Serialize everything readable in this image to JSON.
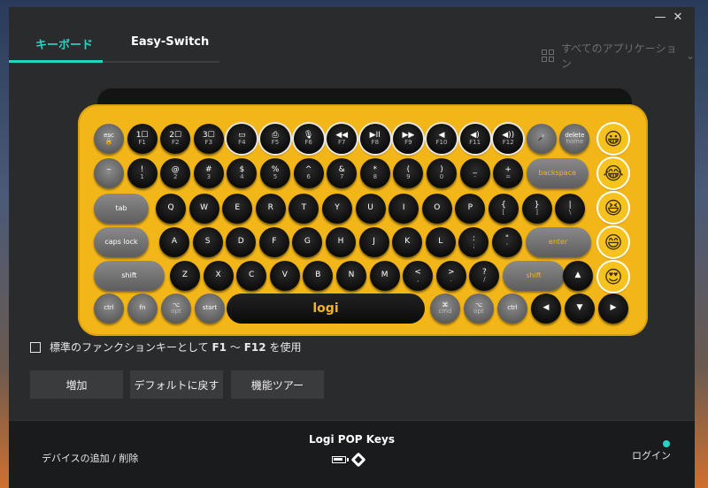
{
  "window": {
    "minimize": "—",
    "close": "✕"
  },
  "tabs": [
    {
      "label": "キーボード"
    },
    {
      "label": "Easy-Switch"
    }
  ],
  "app_switch": {
    "label": "すべてのアプリケーション",
    "chevron": "⌄"
  },
  "keyboard": {
    "brand": "logi",
    "row0": [
      "esc",
      "1☐",
      "2☐",
      "3☐",
      "▭",
      "⎙",
      "🎙",
      "◀◀",
      "▶II",
      "▶▶",
      "◀",
      "◀)",
      "◀))",
      "🎤",
      "delete"
    ],
    "row0_sub": [
      "🔒",
      "F1",
      "F2",
      "F3",
      "F4",
      "F5",
      "F6",
      "F7",
      "F8",
      "F9",
      "F10",
      "F11",
      "F12",
      "",
      "home"
    ],
    "row1": [
      [
        "~",
        "`"
      ],
      [
        "!",
        "1"
      ],
      [
        "@",
        "2"
      ],
      [
        "#",
        "3"
      ],
      [
        "$",
        "4"
      ],
      [
        "%",
        "5"
      ],
      [
        "^",
        "6"
      ],
      [
        "&",
        "7"
      ],
      [
        "*",
        "8"
      ],
      [
        "(",
        "9"
      ],
      [
        ")",
        "0"
      ],
      [
        "_",
        "-"
      ],
      [
        "+",
        "="
      ]
    ],
    "backspace": "backspace",
    "tab": "tab",
    "row2": [
      "Q",
      "W",
      "E",
      "R",
      "T",
      "Y",
      "U",
      "I",
      "O",
      "P"
    ],
    "row2_br": [
      [
        "{",
        "["
      ],
      [
        "}",
        "]"
      ],
      [
        "|",
        "\\"
      ]
    ],
    "capslock": "caps lock",
    "row3": [
      "A",
      "S",
      "D",
      "F",
      "G",
      "H",
      "J",
      "K",
      "L"
    ],
    "row3_punct": [
      [
        ":",
        ";"
      ],
      [
        "\"",
        "'"
      ]
    ],
    "enter": "enter",
    "shift_l": "shift",
    "row4": [
      "Z",
      "X",
      "C",
      "V",
      "B",
      "N",
      "M"
    ],
    "row4_punct": [
      [
        "<",
        ","
      ],
      [
        ">",
        "."
      ],
      [
        "?",
        "/"
      ]
    ],
    "shift_r": "shift",
    "row5_left": [
      [
        "ctrl",
        ""
      ],
      [
        "fn",
        ""
      ],
      [
        "⌥",
        "opt"
      ],
      [
        "start",
        ""
      ],
      [
        "alt",
        ""
      ]
    ],
    "row5_right": [
      [
        "⌘",
        "cmd"
      ],
      [
        "⌥",
        "opt"
      ],
      [
        "ctrl",
        ""
      ]
    ],
    "arrows": [
      "▲",
      "◀",
      "▼",
      "▶"
    ],
    "emoji": [
      "😀",
      "😂",
      "😆",
      "😄",
      "😍"
    ]
  },
  "fn_option": {
    "prefix": "標準のファンクションキーとして",
    "f1": "F1",
    "sep": "〜",
    "f12": "F12",
    "suffix": "を使用"
  },
  "buttons": {
    "add": "増加",
    "reset": "デフォルトに戻す",
    "tour": "機能ツアー"
  },
  "footer": {
    "add_remove": "デバイスの追加 / 削除",
    "device_name": "Logi POP Keys",
    "login": "ログイン"
  },
  "colors": {
    "accent": "#28d3c6",
    "keyboard_yellow": "#f3b618"
  }
}
